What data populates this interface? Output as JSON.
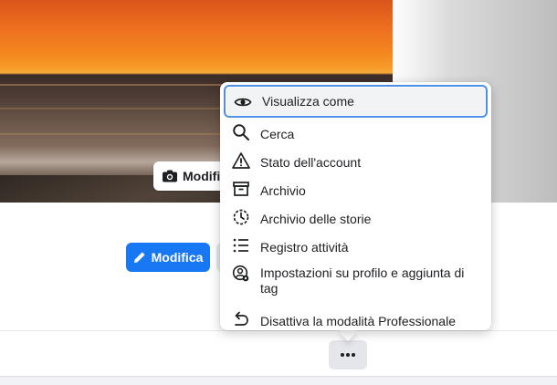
{
  "cover": {
    "edit_label": "Modific"
  },
  "profile": {
    "edit_button_label": "Modifica"
  },
  "menu": {
    "items": [
      {
        "label": "Visualizza come",
        "icon": "eye-icon"
      },
      {
        "label": "Cerca",
        "icon": "search-icon"
      },
      {
        "label": "Stato dell'account",
        "icon": "warning-icon"
      },
      {
        "label": "Archivio",
        "icon": "archive-box-icon"
      },
      {
        "label": "Archivio delle storie",
        "icon": "story-history-icon"
      },
      {
        "label": "Registro attività",
        "icon": "activity-list-icon"
      },
      {
        "label": "Impostazioni su profilo e aggiunta di tag",
        "icon": "profile-settings-icon"
      },
      {
        "label": "Disattiva la modalità Professionale",
        "icon": "undo-icon"
      }
    ]
  },
  "colors": {
    "accent": "#1877f2",
    "focus_ring": "#4f8fe8",
    "button_gray": "#e4e6eb"
  },
  "more_button": {
    "icon": "more-dots-icon"
  }
}
